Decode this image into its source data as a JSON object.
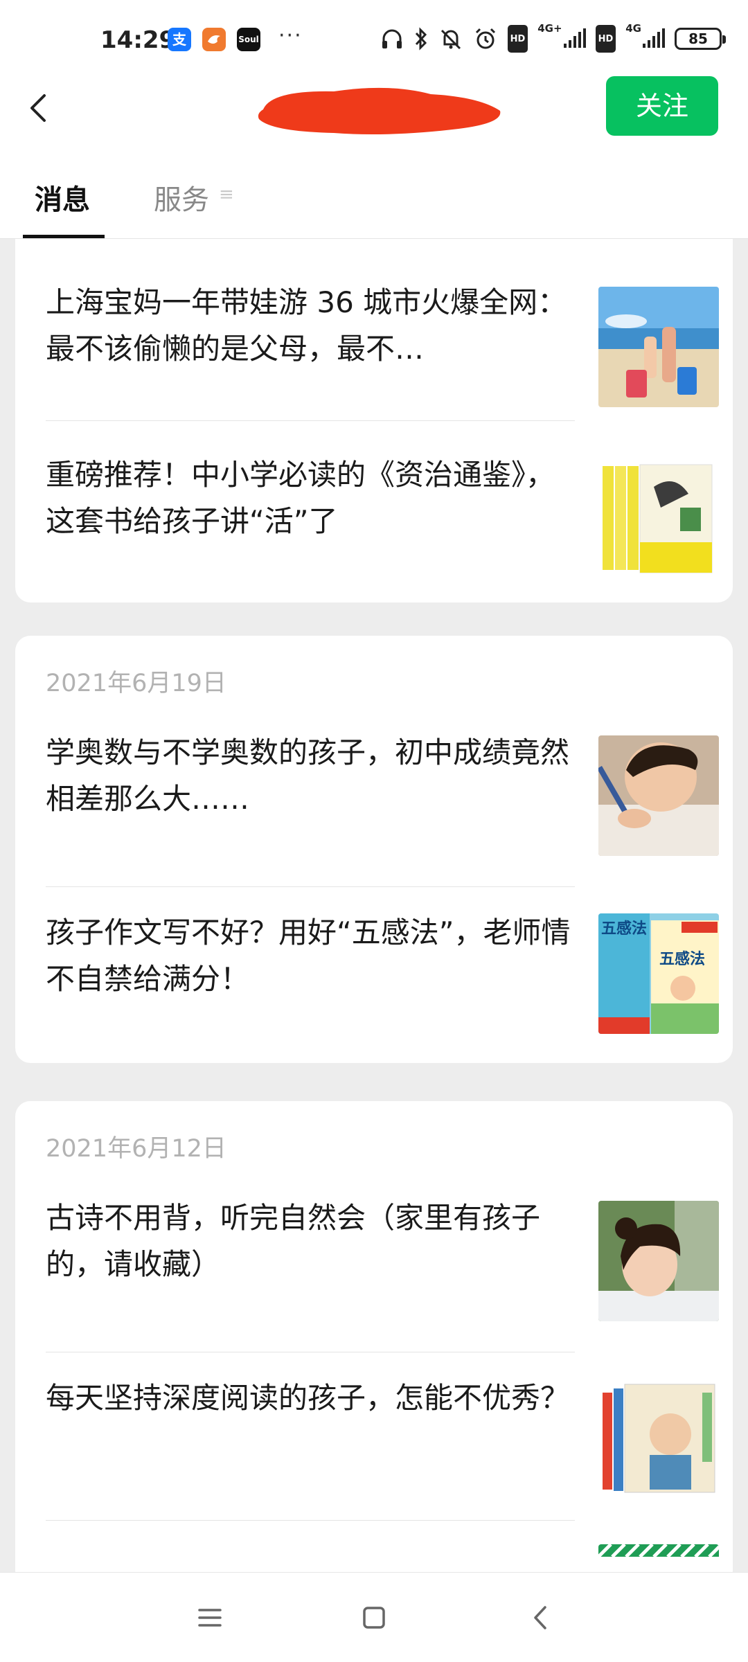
{
  "status_bar": {
    "time": "14:29",
    "app_icons": [
      "alipay-icon",
      "bird-app-icon",
      "soul-app-icon"
    ],
    "soul_label": "Soul",
    "more": "···",
    "hd1": "HD",
    "network1": "4G+",
    "hd2": "HD",
    "network2": "4G",
    "battery": "85"
  },
  "header": {
    "follow_label": "关注",
    "follow_color": "#07c160"
  },
  "tabs": {
    "messages": "消息",
    "services": "服务"
  },
  "feed": {
    "groups": [
      {
        "articles": [
          {
            "title": "上海宝妈一年带娃游 36 城市火爆全网：最不该偷懒的是父母，最不…"
          },
          {
            "title": "重磅推荐！中小学必读的《资治通鉴》，这套书给孩子讲“活”了"
          }
        ]
      },
      {
        "date": "2021年6月19日",
        "articles": [
          {
            "title": " 学奥数与不学奥数的孩子，初中成绩竟然相差那么大……"
          },
          {
            "title": "孩子作文写不好？用好“五感法”，老师情不自禁给满分！"
          }
        ]
      },
      {
        "date": "2021年6月12日",
        "articles": [
          {
            "title": "古诗不用背，听完自然会（家里有孩子的，请收藏）"
          },
          {
            "title": "每天坚持深度阅读的孩子，怎能不优秀？"
          }
        ]
      }
    ],
    "book_cover_text": "五感法"
  },
  "nav": {
    "icons": [
      "menu-icon",
      "home-icon",
      "back-icon"
    ]
  }
}
